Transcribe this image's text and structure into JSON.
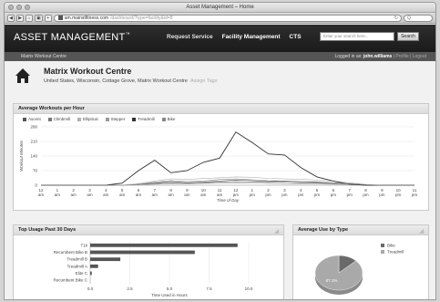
{
  "browser": {
    "window_title": "Asset Management – Home",
    "url_host": "am.mainstfitness.com",
    "url_path": "/dashboard/?type=facility&id=8",
    "search_placeholder": "Q"
  },
  "site": {
    "logo": "ASSET MANAGEMENT",
    "logo_tm": "™",
    "nav": [
      "Request Service",
      "Facility Management",
      "CTS"
    ],
    "search_placeholder": "Enter your search here...",
    "search_button": "Search",
    "breadcrumb": "Matrix Workout Centre",
    "logged_in_label": "Logged in as:",
    "user": "john.williams",
    "profile": "Profile",
    "logout": "Logout"
  },
  "centre": {
    "title": "Matrix Workout Centre",
    "location": "United States, Wisconsin, Cottage Grove, Matrix Workout Centre",
    "assign_tags": "Assign Tags"
  },
  "workouts_panel": {
    "title": "Average Workouts per Hour"
  },
  "usage_panel": {
    "title": "Top Usage Past 30 Days"
  },
  "type_panel": {
    "title": "Average Use by Type"
  },
  "chart_data": [
    {
      "type": "line",
      "title": "Average Workouts per Hour",
      "ylabel": "Workout Minutes",
      "xlabel": "Time of Day",
      "ylim": [
        0,
        280
      ],
      "yticks": [
        0,
        70,
        140,
        210,
        280
      ],
      "x": [
        "12 am",
        "1 am",
        "2 am",
        "3 am",
        "4 am",
        "5 am",
        "6 am",
        "7 am",
        "8 am",
        "9 am",
        "10 am",
        "11 am",
        "12 pm",
        "1 pm",
        "2 pm",
        "3 pm",
        "4 pm",
        "5 pm",
        "6 pm",
        "7 pm",
        "8 pm",
        "9 pm",
        "10 pm",
        "11 pm"
      ],
      "series": [
        {
          "name": "Ascent",
          "color": "#555555",
          "values": [
            0,
            0,
            0,
            0,
            0,
            0,
            5,
            10,
            18,
            12,
            15,
            20,
            25,
            22,
            18,
            20,
            16,
            14,
            12,
            8,
            3,
            0,
            0,
            0
          ]
        },
        {
          "name": "Climbmill",
          "color": "#777777",
          "values": [
            0,
            0,
            0,
            0,
            0,
            0,
            3,
            8,
            12,
            10,
            12,
            15,
            18,
            16,
            14,
            15,
            12,
            10,
            8,
            5,
            2,
            0,
            0,
            0
          ]
        },
        {
          "name": "Elliptical",
          "color": "#b0b0b0",
          "values": [
            0,
            0,
            0,
            0,
            0,
            0,
            8,
            20,
            30,
            28,
            32,
            36,
            40,
            38,
            33,
            30,
            28,
            25,
            20,
            12,
            4,
            0,
            0,
            0
          ]
        },
        {
          "name": "Stepper",
          "color": "#999999",
          "values": [
            0,
            0,
            0,
            0,
            0,
            0,
            2,
            5,
            8,
            7,
            9,
            10,
            12,
            11,
            9,
            8,
            7,
            6,
            5,
            3,
            1,
            0,
            0,
            0
          ]
        },
        {
          "name": "Treadmill",
          "color": "#333333",
          "values": [
            0,
            0,
            0,
            0,
            0,
            10,
            70,
            120,
            60,
            70,
            110,
            130,
            255,
            205,
            150,
            145,
            85,
            40,
            20,
            5,
            0,
            0,
            0,
            0
          ]
        },
        {
          "name": "Bike",
          "color": "#888888",
          "values": [
            0,
            0,
            0,
            0,
            0,
            0,
            4,
            15,
            22,
            18,
            20,
            28,
            30,
            26,
            22,
            20,
            18,
            16,
            12,
            6,
            2,
            0,
            0,
            0
          ]
        }
      ]
    },
    {
      "type": "bar",
      "orientation": "horizontal",
      "categories": [
        "T1k",
        "Recumbent Bike B",
        "Treadmill B",
        "Treadmill A",
        "Elite C",
        "Recumbent Bike C"
      ],
      "values": [
        9.3,
        6.6,
        1.9,
        0.5,
        0.1,
        0.0
      ],
      "xlabel": "Time Used in Hours",
      "xlim": [
        0,
        10
      ],
      "xticks": [
        0,
        2.5,
        5,
        7.5,
        10
      ],
      "xtick_labels": [
        "0.0",
        "2.5",
        "5.0",
        "7.5",
        "10.0"
      ]
    },
    {
      "type": "pie",
      "slices": [
        {
          "name": "Bike",
          "value": 12.9,
          "color": "#6a6a6a"
        },
        {
          "name": "Treadmill",
          "value": 87.1,
          "color": "#a9a9a9"
        }
      ],
      "labels": [
        "87.1%"
      ]
    }
  ]
}
